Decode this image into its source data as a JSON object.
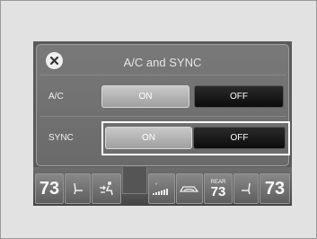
{
  "dialog": {
    "title": "A/C and SYNC",
    "rows": [
      {
        "label": "A/C",
        "on_label": "ON",
        "off_label": "OFF"
      },
      {
        "label": "SYNC",
        "on_label": "ON",
        "off_label": "OFF"
      }
    ]
  },
  "bottom_bar": {
    "driver_temp": "73",
    "passenger_temp": "73",
    "rear_label": "REAR",
    "rear_temp": "73"
  },
  "icons": {
    "close": "close-icon",
    "driver_seat_heat": "seat-heater-icon",
    "airflow": "airflow-mode-icon",
    "fan": "fan-speed-icon",
    "recirculation": "car-recirculation-icon",
    "passenger_seat_heat": "seat-heater-icon"
  }
}
